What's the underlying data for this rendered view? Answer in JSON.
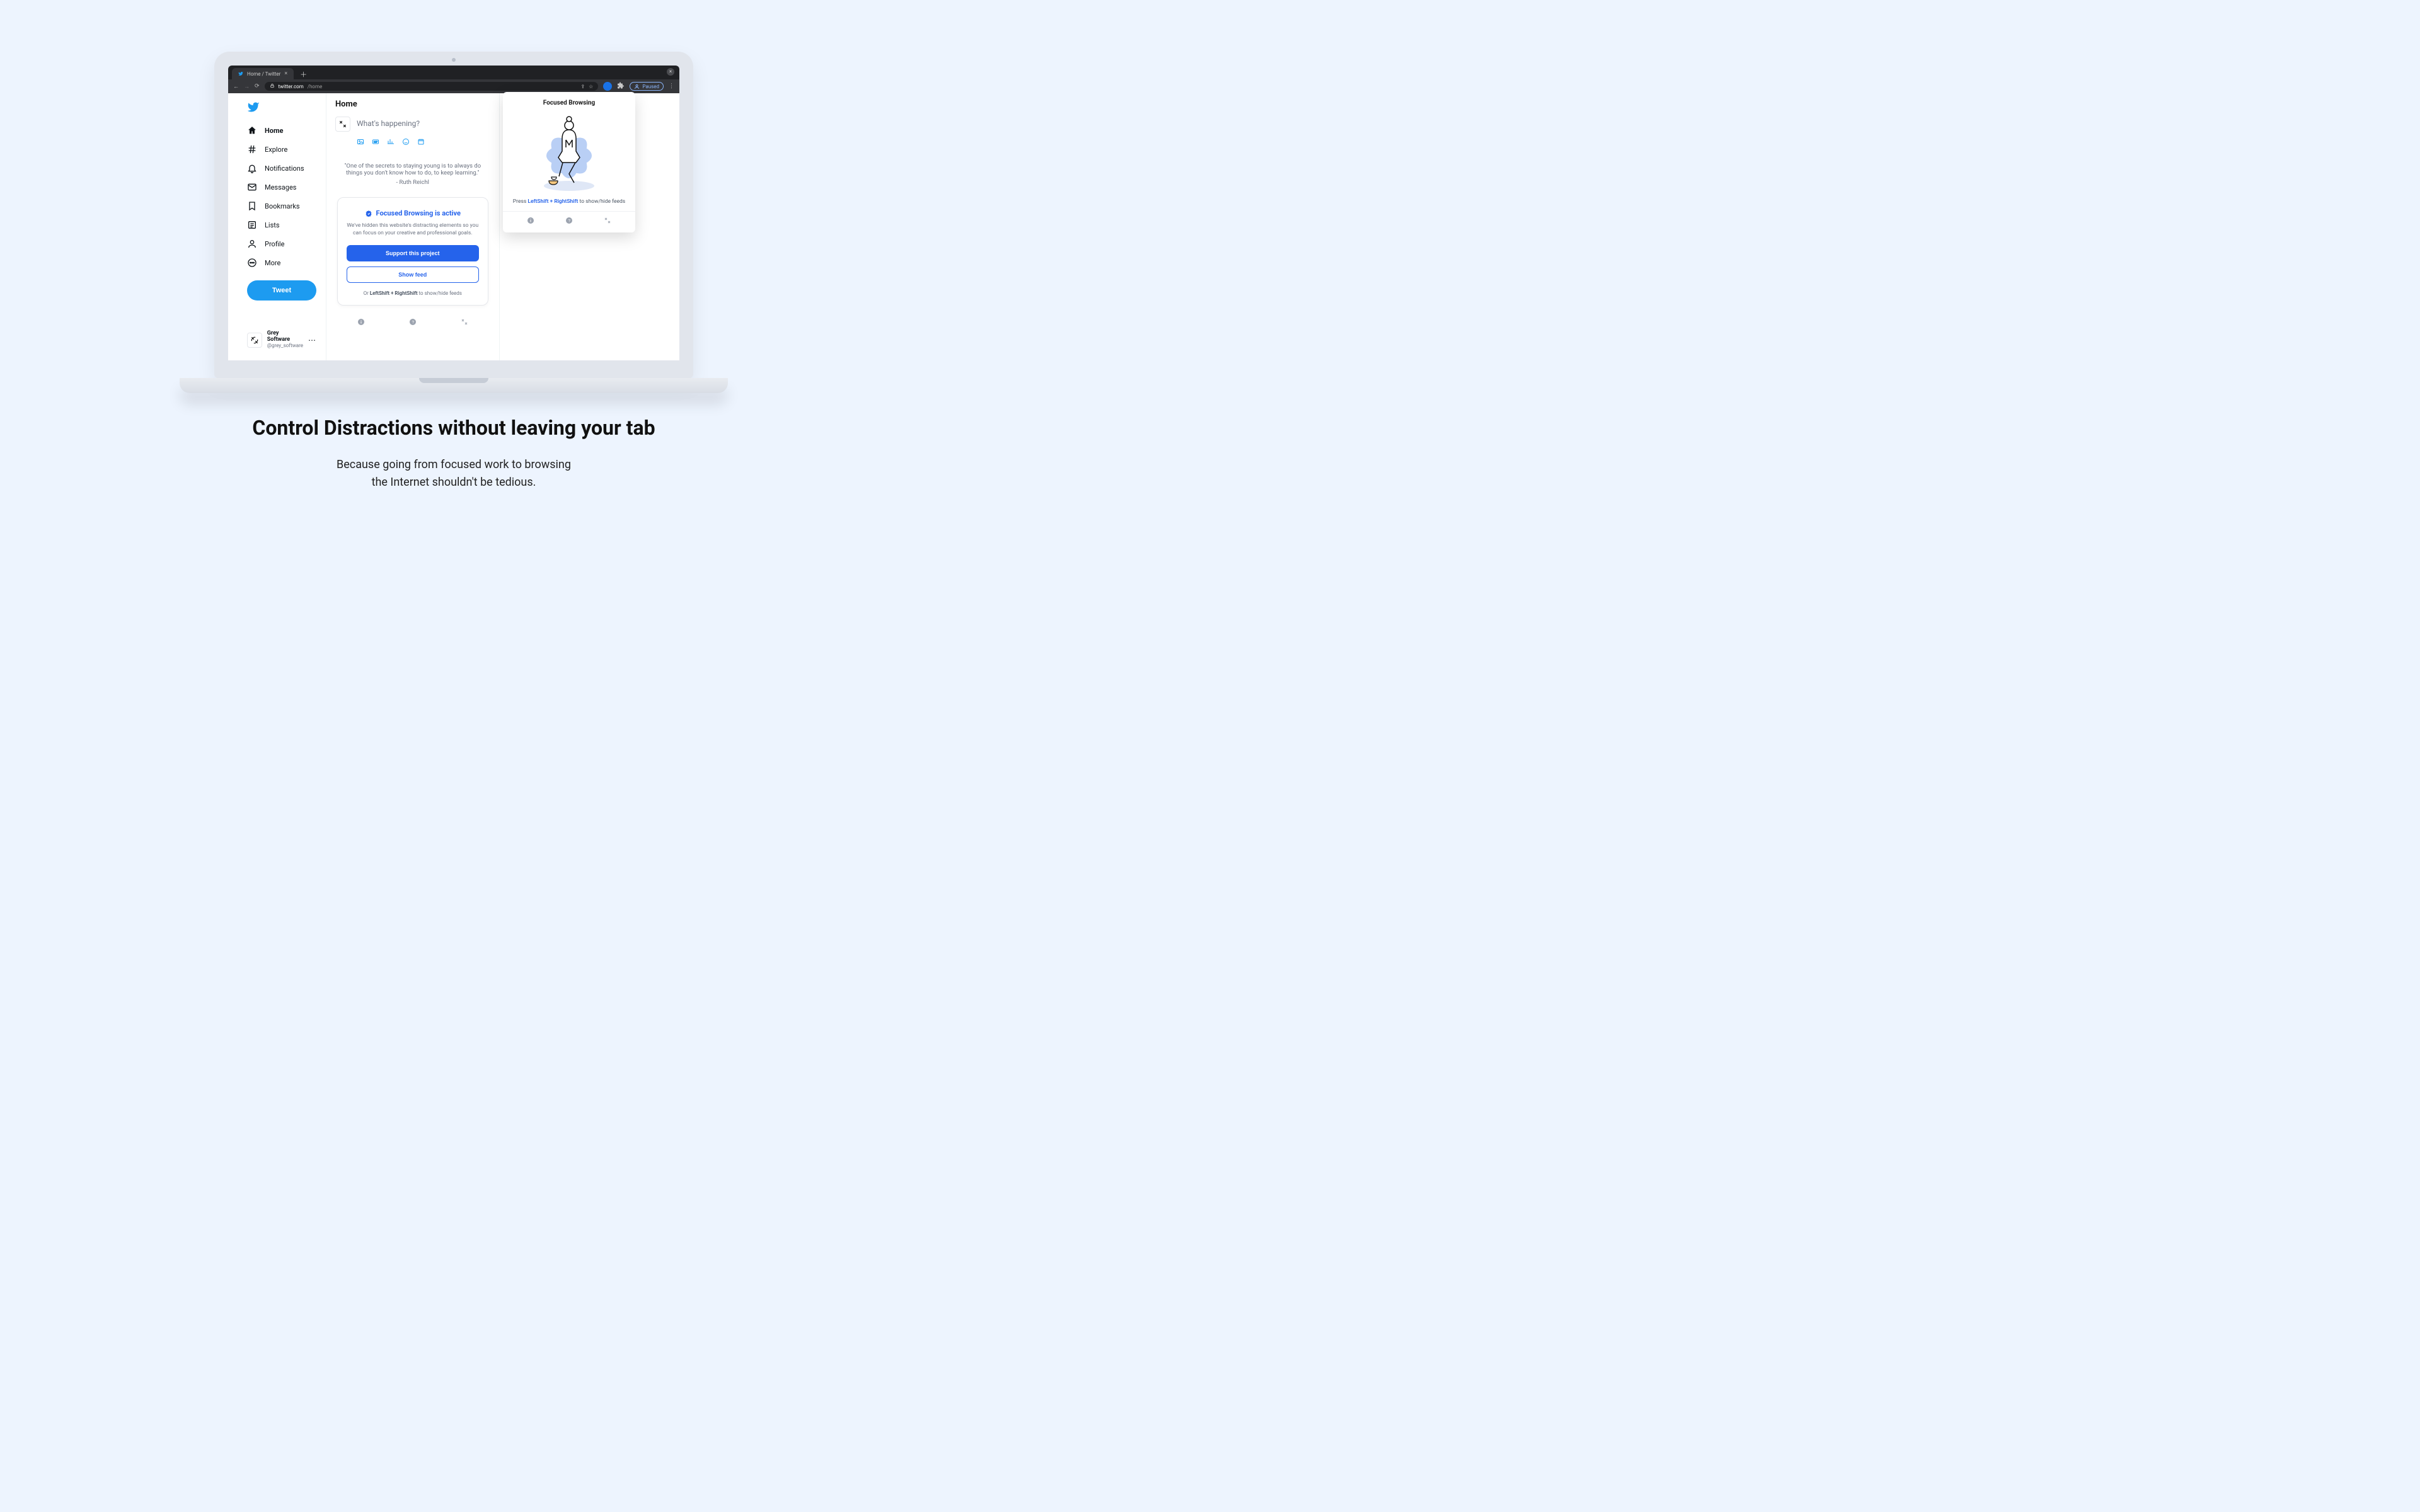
{
  "browser": {
    "tab_title": "Home / Twitter",
    "url_domain": "twitter.com",
    "url_path": "/home",
    "paused_label": "Paused"
  },
  "sidebar": {
    "items": [
      {
        "label": "Home"
      },
      {
        "label": "Explore"
      },
      {
        "label": "Notifications"
      },
      {
        "label": "Messages"
      },
      {
        "label": "Bookmarks"
      },
      {
        "label": "Lists"
      },
      {
        "label": "Profile"
      },
      {
        "label": "More"
      }
    ],
    "tweet_label": "Tweet",
    "account_name": "Grey Software",
    "account_handle": "@grey_software"
  },
  "feed": {
    "header": "Home",
    "compose_placeholder": "What's happening?",
    "quote_text": "\"One of the secrets to staying young is to always do things you don't know how to do, to keep learning.\"",
    "quote_author": "- Ruth Reichl"
  },
  "focus_card": {
    "title": "Focused Browsing is active",
    "subtitle": "We've hidden this website's distracting elements so you can focus on your creative and professional goals.",
    "support_label": "Support this project",
    "showfeed_label": "Show feed",
    "hint_prefix": "Or ",
    "hint_kbd": "LeftShift + RightShift",
    "hint_suffix": " to show/hide feeds"
  },
  "ext_popup": {
    "title": "Focused Browsing",
    "hint_prefix": "Press ",
    "hint_kbd": "LeftShift + RightShift",
    "hint_suffix": " to show/hide feeds"
  },
  "hero": {
    "title": "Control Distractions without leaving your tab",
    "subtitle_l1": "Because going from focused work to browsing",
    "subtitle_l2": "the Internet shouldn't be tedious."
  }
}
